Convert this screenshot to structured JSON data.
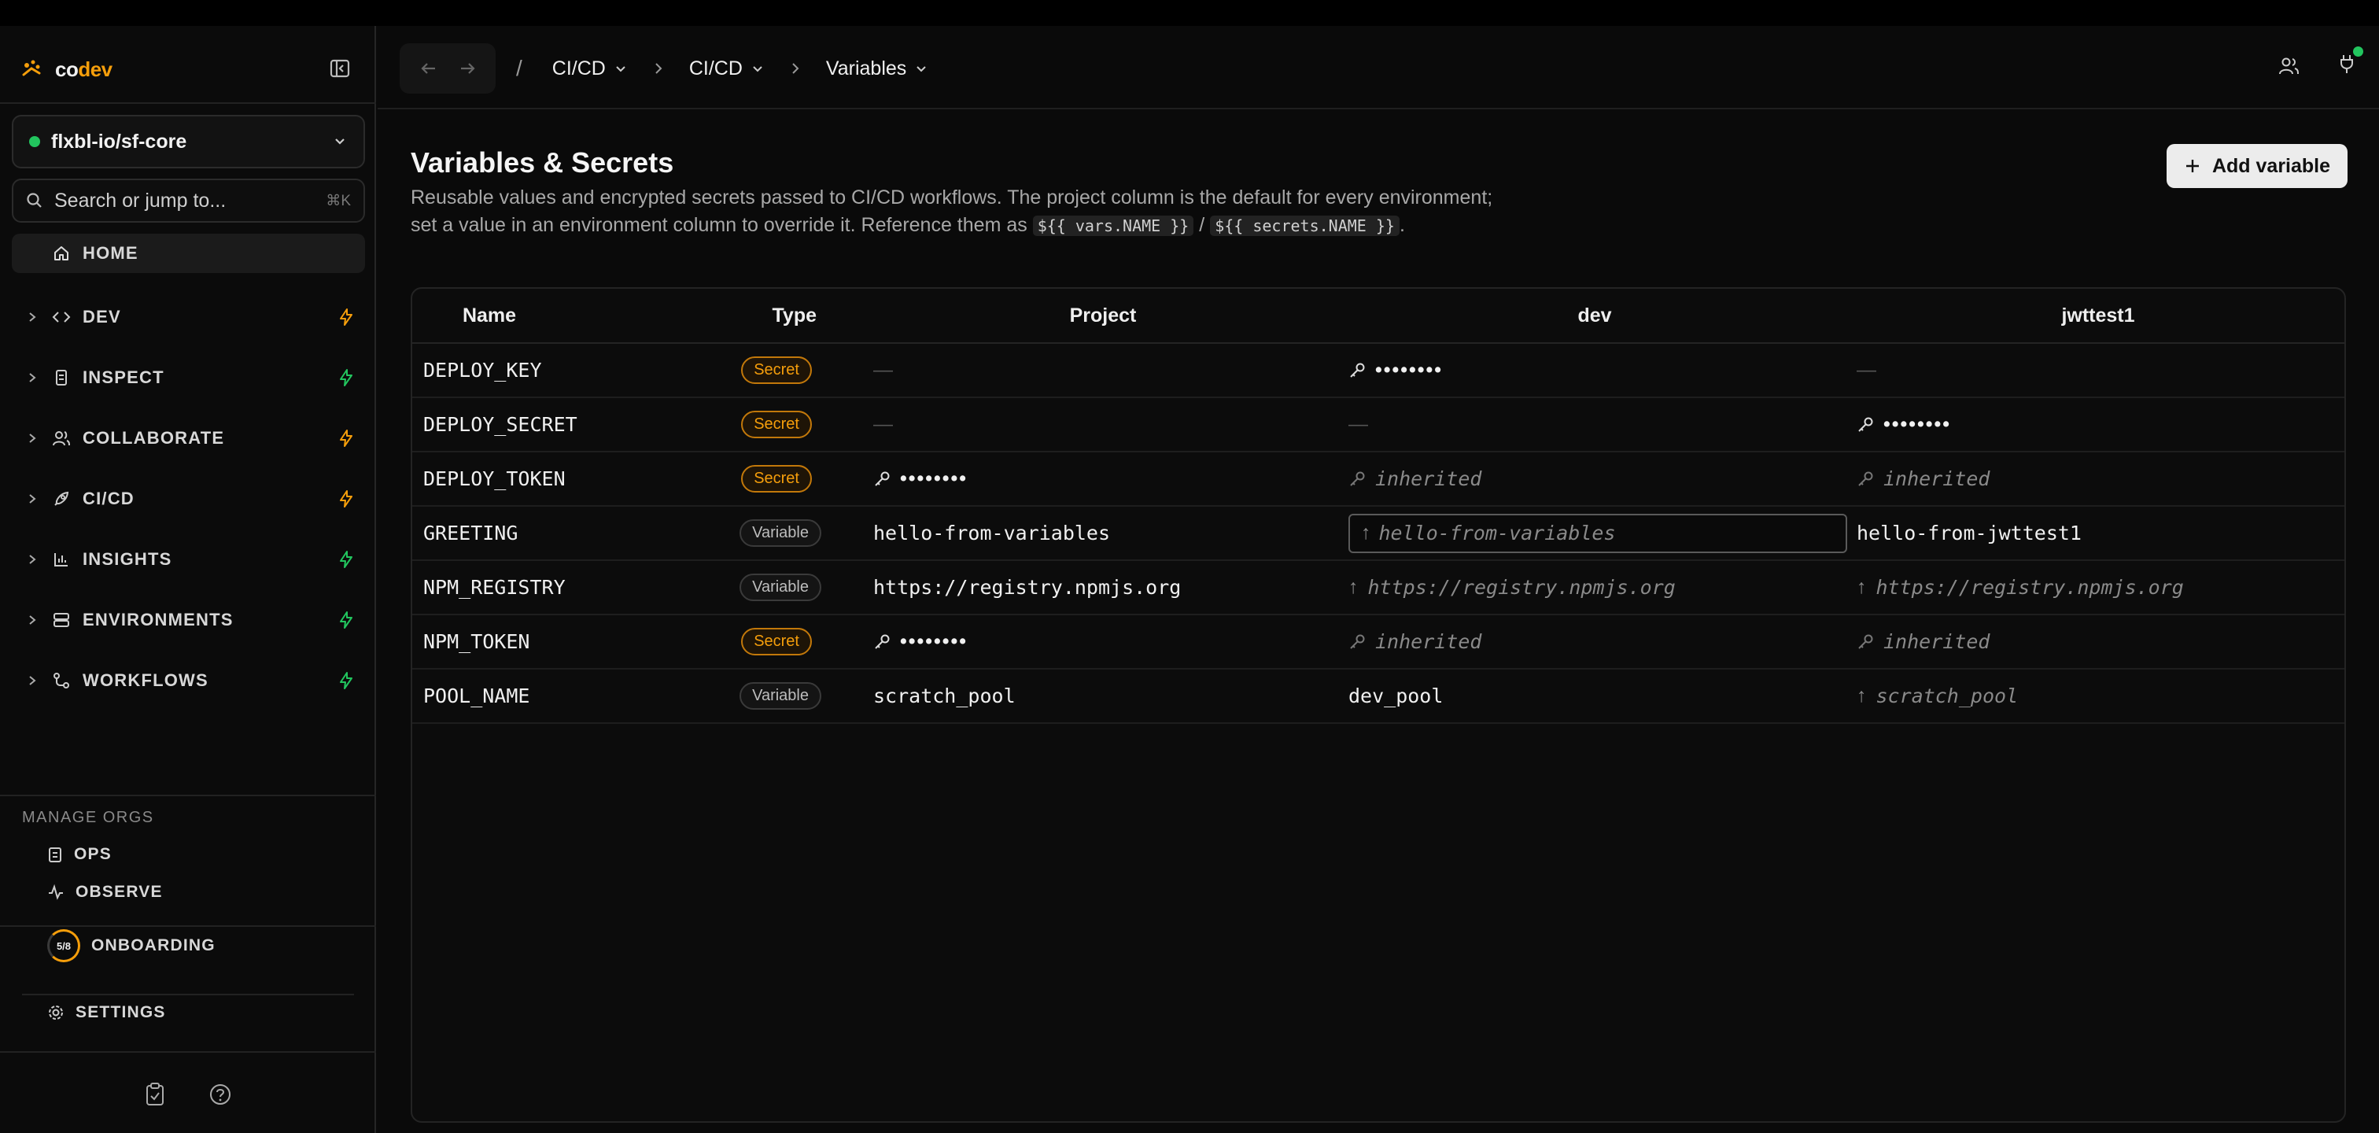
{
  "app": {
    "brand_prefix": "co",
    "brand_suffix": "dev"
  },
  "sidebar": {
    "project": "flxbl-io/sf-core",
    "search_placeholder": "Search or jump to...",
    "search_shortcut": "⌘K",
    "home": "HOME",
    "items": [
      {
        "label": "DEV",
        "icon": "code-icon",
        "bolt_color": "#f59e0b"
      },
      {
        "label": "INSPECT",
        "icon": "inspect-icon",
        "bolt_color": "#22c55e"
      },
      {
        "label": "COLLABORATE",
        "icon": "users-icon",
        "bolt_color": "#f59e0b"
      },
      {
        "label": "CI/CD",
        "icon": "rocket-icon",
        "bolt_color": "#f59e0b"
      },
      {
        "label": "INSIGHTS",
        "icon": "bar-chart-icon",
        "bolt_color": "#22c55e"
      },
      {
        "label": "ENVIRONMENTS",
        "icon": "server-icon",
        "bolt_color": "#22c55e"
      },
      {
        "label": "WORKFLOWS",
        "icon": "workflow-icon",
        "bolt_color": "#22c55e"
      }
    ],
    "manage_title": "MANAGE ORGS",
    "ops": "OPS",
    "observe": "OBSERVE",
    "onboarding": "ONBOARDING",
    "onboarding_progress": "5/8",
    "settings": "SETTINGS"
  },
  "header": {
    "root_sep": "/",
    "crumbs": [
      "CI/CD",
      "CI/CD",
      "Variables"
    ]
  },
  "main": {
    "title": "Variables & Secrets",
    "desc_1": "Reusable values and encrypted secrets passed to CI/CD workflows. The project column is the default for every environment; set a value in an environment column to override it. Reference them as ",
    "code_1": "${{ vars.NAME }}",
    "desc_sep": " / ",
    "code_2": "${{ secrets.NAME }}",
    "desc_end": ".",
    "add_button": "Add variable"
  },
  "table": {
    "columns": [
      "Name",
      "Type",
      "Project",
      "dev",
      "jwttest1"
    ],
    "masked": "••••••••",
    "inherited": "inherited",
    "dash": "—",
    "rows": [
      {
        "name": "DEPLOY_KEY",
        "type": "Secret",
        "project": "—",
        "dev": "••••••••",
        "jwttest1": "—"
      },
      {
        "name": "DEPLOY_SECRET",
        "type": "Secret",
        "project": "—",
        "dev": "—",
        "jwttest1": "••••••••"
      },
      {
        "name": "DEPLOY_TOKEN",
        "type": "Secret",
        "project": "••••••••",
        "dev": "inherited",
        "jwttest1": "inherited"
      },
      {
        "name": "GREETING",
        "type": "Variable",
        "project": "hello-from-variables",
        "dev": "hello-from-variables",
        "jwttest1": "hello-from-jwttest1"
      },
      {
        "name": "NPM_REGISTRY",
        "type": "Variable",
        "project": "https://registry.npmjs.org",
        "dev": "https://registry.npmjs.org",
        "jwttest1": "https://registry.npmjs.org"
      },
      {
        "name": "NPM_TOKEN",
        "type": "Secret",
        "project": "••••••••",
        "dev": "inherited",
        "jwttest1": "inherited"
      },
      {
        "name": "POOL_NAME",
        "type": "Variable",
        "project": "scratch_pool",
        "dev": "dev_pool",
        "jwttest1": "scratch_pool"
      }
    ]
  }
}
